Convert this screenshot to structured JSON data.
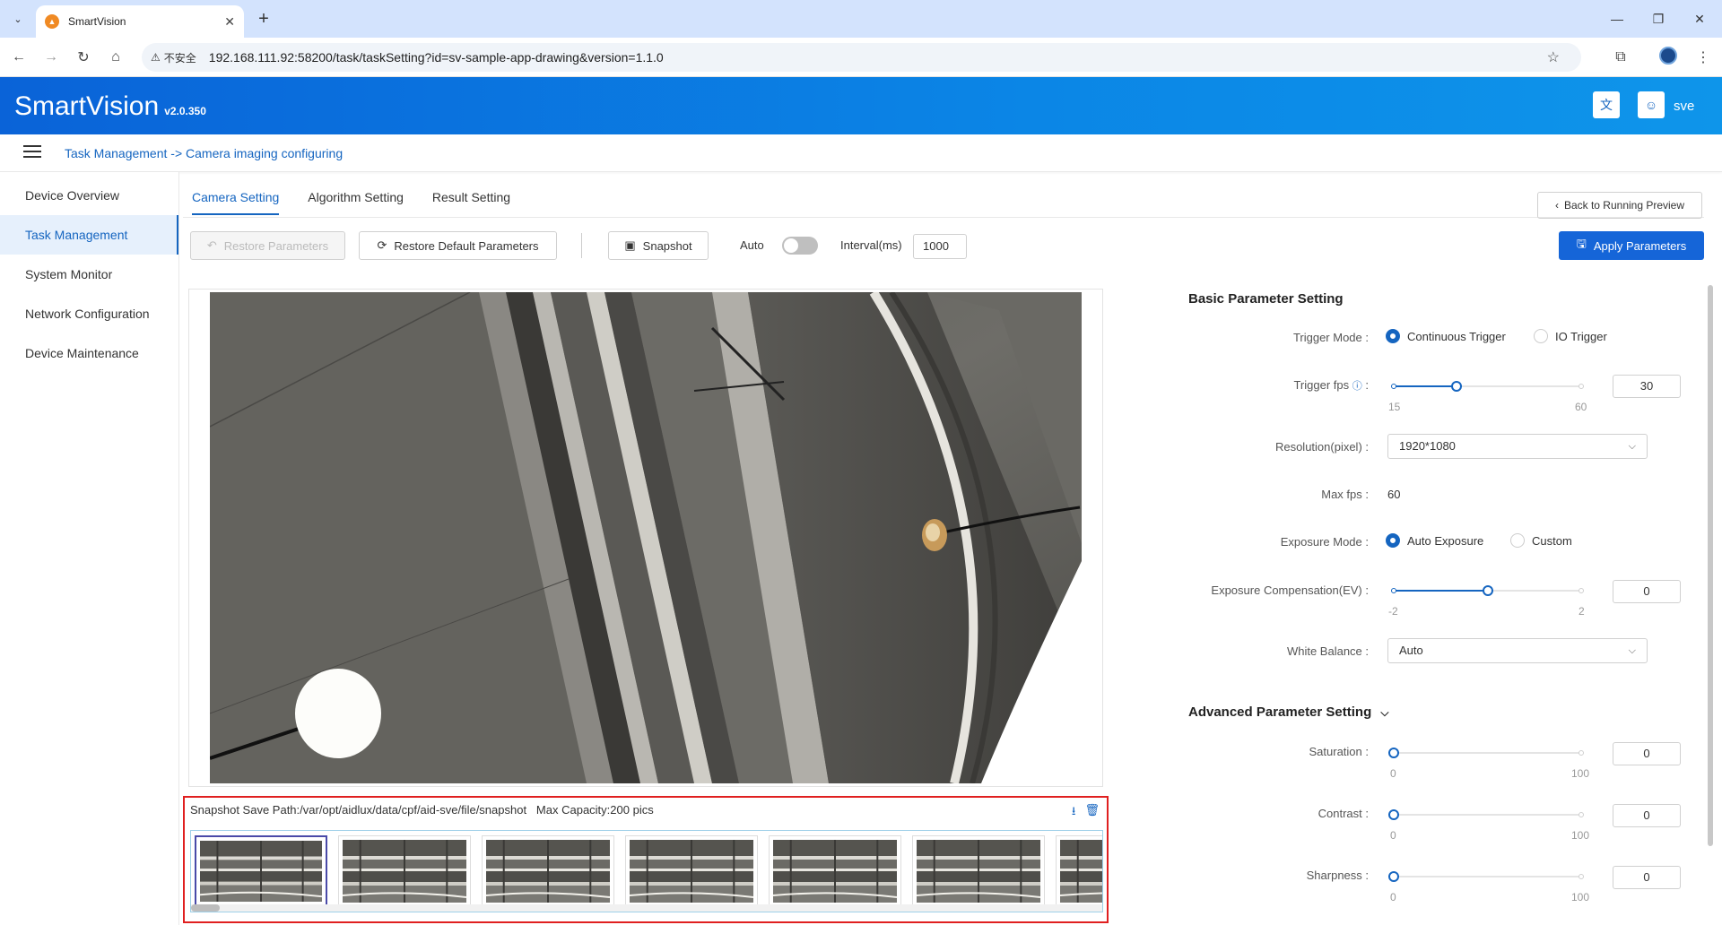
{
  "browser": {
    "tab_title": "SmartVision",
    "insecure_label": "不安全",
    "url": "192.168.111.92:58200/task/taskSetting?id=sv-sample-app-drawing&version=1.1.0"
  },
  "header": {
    "app_name": "SmartVision",
    "version": "v2.0.350",
    "user": "sve"
  },
  "breadcrumb": "Task Management -> Camera imaging configuring",
  "sidebar": {
    "items": [
      {
        "label": "Device Overview"
      },
      {
        "label": "Task Management"
      },
      {
        "label": "System Monitor"
      },
      {
        "label": "Network Configuration"
      },
      {
        "label": "Device Maintenance"
      }
    ],
    "active_index": 1
  },
  "tabs": {
    "camera": "Camera Setting",
    "algorithm": "Algorithm Setting",
    "result": "Result Setting"
  },
  "back_button": "Back to Running Preview",
  "toolbar": {
    "restore": "Restore Parameters",
    "restore_default": "Restore Default Parameters",
    "snapshot": "Snapshot",
    "auto_label": "Auto",
    "auto_on": false,
    "interval_label": "Interval(ms)",
    "interval_value": "1000",
    "apply": "Apply Parameters"
  },
  "snapshots": {
    "save_path": "Snapshot Save Path:/var/opt/aidlux/data/cpf/aid-sve/file/snapshot",
    "capacity": "Max Capacity:200 pics",
    "count_visible": 7
  },
  "basic": {
    "title": "Basic Parameter Setting",
    "trigger_mode_label": "Trigger Mode :",
    "trigger_continuous": "Continuous Trigger",
    "trigger_io": "IO Trigger",
    "trigger_fps_label": "Trigger fps",
    "trigger_fps_colon": ":",
    "trigger_fps_min": "15",
    "trigger_fps_max": "60",
    "trigger_fps_value": "30",
    "resolution_label": "Resolution(pixel) :",
    "resolution_value": "1920*1080",
    "max_fps_label": "Max fps :",
    "max_fps_value": "60",
    "exposure_mode_label": "Exposure Mode :",
    "exposure_auto": "Auto Exposure",
    "exposure_custom": "Custom",
    "ev_label": "Exposure Compensation(EV) :",
    "ev_min": "-2",
    "ev_max": "2",
    "ev_value": "0",
    "wb_label": "White Balance :",
    "wb_value": "Auto"
  },
  "advanced": {
    "title": "Advanced Parameter Setting",
    "saturation_label": "Saturation :",
    "saturation_value": "0",
    "contrast_label": "Contrast :",
    "contrast_value": "0",
    "sharpness_label": "Sharpness :",
    "sharpness_value": "0",
    "min": "0",
    "max": "100"
  },
  "colors": {
    "accent": "#1565c0",
    "header_start": "#0a63d8",
    "header_end": "#0e95ea",
    "snapshot_border": "#e02020"
  }
}
